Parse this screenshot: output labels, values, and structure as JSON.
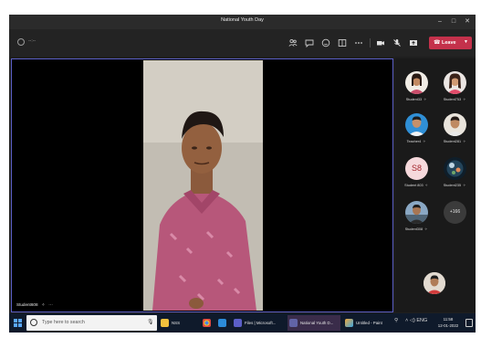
{
  "window": {
    "title": "National Youth Day",
    "minimize_glyph": "–",
    "maximize_glyph": "□",
    "close_glyph": "✕"
  },
  "toolbar": {
    "timer_value": "--:--",
    "leave_label": "Leave",
    "leave_color": "#c4314b",
    "buttons": [
      "people-icon",
      "chat-icon",
      "reactions-icon",
      "share-icon",
      "more-icon",
      "camera-icon",
      "mic-icon",
      "share-screen-icon"
    ]
  },
  "stage": {
    "speaker_name": "Student608",
    "speaker_mic_glyph": "✧",
    "speaker_more_glyph": "···",
    "active_border_color": "#5b5fc7"
  },
  "participants": [
    {
      "name": "Student33",
      "mic": "✧"
    },
    {
      "name": "Student753",
      "mic": "✧"
    },
    {
      "name": "Teacher4",
      "mic": "✧"
    },
    {
      "name": "Student281",
      "mic": "✧"
    },
    {
      "name": "Student 803",
      "initials": "S8",
      "mic": "✧"
    },
    {
      "name": "Student235",
      "mic": "✧"
    },
    {
      "name": "Student308",
      "mic": "✧"
    }
  ],
  "overflow_count": "+166",
  "taskbar": {
    "search_placeholder": "Type here to search",
    "items": [
      {
        "label": "NSS"
      },
      {
        "label": "Files | Microsoft..."
      },
      {
        "label": "National Youth D..."
      },
      {
        "label": "Untitled - Paint"
      }
    ],
    "tray_glyphs": "˄  ◁)  ENG",
    "time": "11:58",
    "date": "12-01-2022"
  }
}
